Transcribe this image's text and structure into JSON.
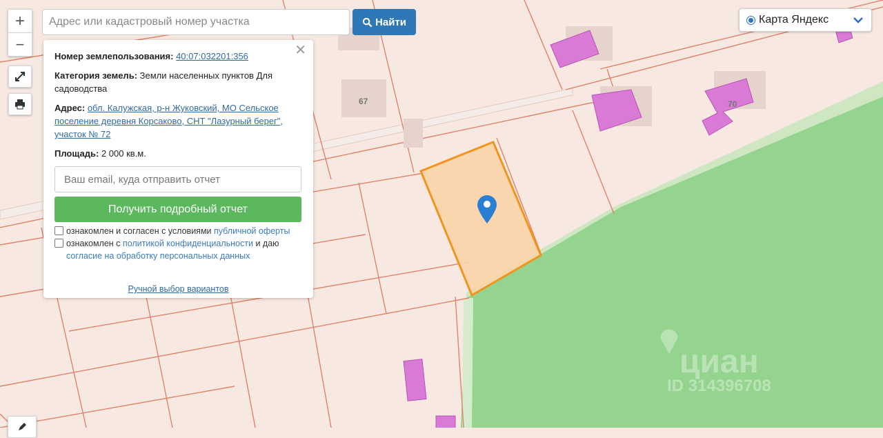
{
  "search": {
    "placeholder": "Адрес или кадастровый номер участка",
    "button_label": "Найти"
  },
  "zoom": {
    "in": "+",
    "out": "−"
  },
  "layer_select": {
    "label": "Карта Яндекс"
  },
  "panel": {
    "land_use_label": "Номер землепользования:",
    "land_use_value": "40:07:032201:356",
    "category_label": "Категория земель:",
    "category_value": "Земли населенных пунктов Для садоводства",
    "address_label": "Адрес:",
    "address_value": "обл. Калужская, р-н Жуковский, МО Сельское поселение деревня Корсаково, СНТ \"Лазурный берег\", участок № 72",
    "area_label": "Площадь:",
    "area_value": "2 000 кв.м.",
    "email_placeholder": "Ваш email, куда отправить отчет",
    "report_button": "Получить подробный отчет",
    "consent1_text": "ознакомлен и согласен с условиями",
    "consent1_link": "публичной оферты",
    "consent2_text_a": "ознакомлен с",
    "consent2_link_a": "политикой конфиденциальности",
    "consent2_text_b": "и даю",
    "consent2_link_b": "согласие на обработку персональных данных",
    "manual_link": "Ручной выбор вариантов",
    "close": "✕"
  },
  "map": {
    "house_labels": [
      "67",
      "70"
    ],
    "watermark_brand": "циан",
    "watermark_id": "ID 314396708",
    "colors": {
      "background": "#f7e9e2",
      "parcel_line": "#e0826a",
      "forest": "#94d48e",
      "building": "#d97ad6",
      "selected_fill": "#f8d4a8",
      "selected_stroke": "#f0941e",
      "pin": "#2a7fd4"
    }
  }
}
